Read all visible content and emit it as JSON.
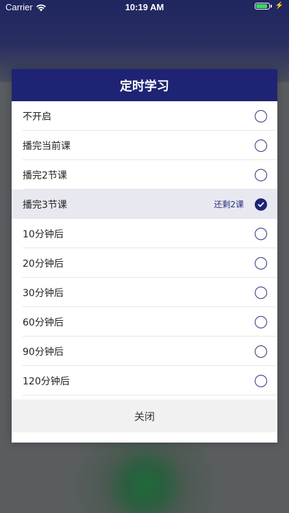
{
  "status_bar": {
    "carrier": "Carrier",
    "time": "10:19 AM",
    "battery_level": 0.9,
    "icons": [
      "wifi-icon",
      "battery-icon",
      "charging-bolt-icon"
    ]
  },
  "modal": {
    "title": "定时学习",
    "options": [
      {
        "label": "不开启",
        "note": "",
        "selected": false
      },
      {
        "label": "播完当前课",
        "note": "",
        "selected": false
      },
      {
        "label": "播完2节课",
        "note": "",
        "selected": false
      },
      {
        "label": "播完3节课",
        "note": "还剩2课",
        "selected": true
      },
      {
        "label": "10分钟后",
        "note": "",
        "selected": false
      },
      {
        "label": "20分钟后",
        "note": "",
        "selected": false
      },
      {
        "label": "30分钟后",
        "note": "",
        "selected": false
      },
      {
        "label": "60分钟后",
        "note": "",
        "selected": false
      },
      {
        "label": "90分钟后",
        "note": "",
        "selected": false
      },
      {
        "label": "120分钟后",
        "note": "",
        "selected": false
      }
    ],
    "close_label": "关闭"
  },
  "colors": {
    "header_bg": "#1e2473",
    "accent": "#2a2f78",
    "selected_row_bg": "#e8e8f0"
  }
}
